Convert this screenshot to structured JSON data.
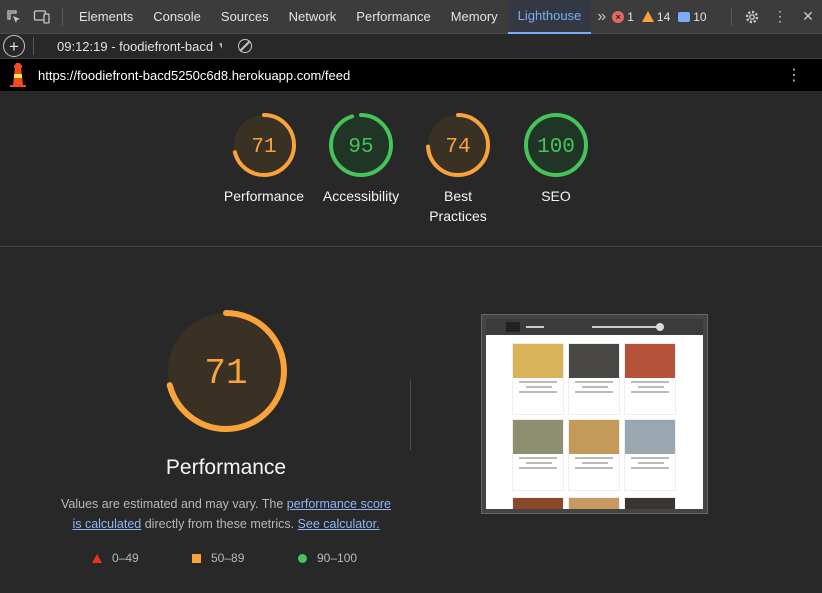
{
  "tabbar": {
    "tabs": [
      "Elements",
      "Console",
      "Sources",
      "Network",
      "Performance",
      "Memory",
      "Lighthouse"
    ],
    "active_tab": "Lighthouse",
    "errors": "1",
    "warnings": "14",
    "messages": "10"
  },
  "toolbar": {
    "report_label": "09:12:19 - foodiefront-bacd"
  },
  "urlbar": {
    "url": "https://foodiefront-bacd5250c6d8.herokuapp.com/feed"
  },
  "scores": [
    {
      "label": "Performance",
      "value": 71,
      "color": "#f9a33a"
    },
    {
      "label": "Accessibility",
      "value": 95,
      "color": "#44c45a"
    },
    {
      "label": "Best Practices",
      "value": 74,
      "color": "#f9a33a"
    },
    {
      "label": "SEO",
      "value": 100,
      "color": "#44c45a"
    }
  ],
  "performance_section": {
    "score": 71,
    "title": "Performance",
    "desc_prefix": "Values are estimated and may vary. The ",
    "link1": "performance score is calculated",
    "desc_mid": " directly from these metrics. ",
    "link2": "See calculator."
  },
  "legend": [
    {
      "range": "0–49",
      "color": "#e8331f"
    },
    {
      "range": "50–89",
      "color": "#f9a33a"
    },
    {
      "range": "90–100",
      "color": "#44c45a"
    }
  ]
}
